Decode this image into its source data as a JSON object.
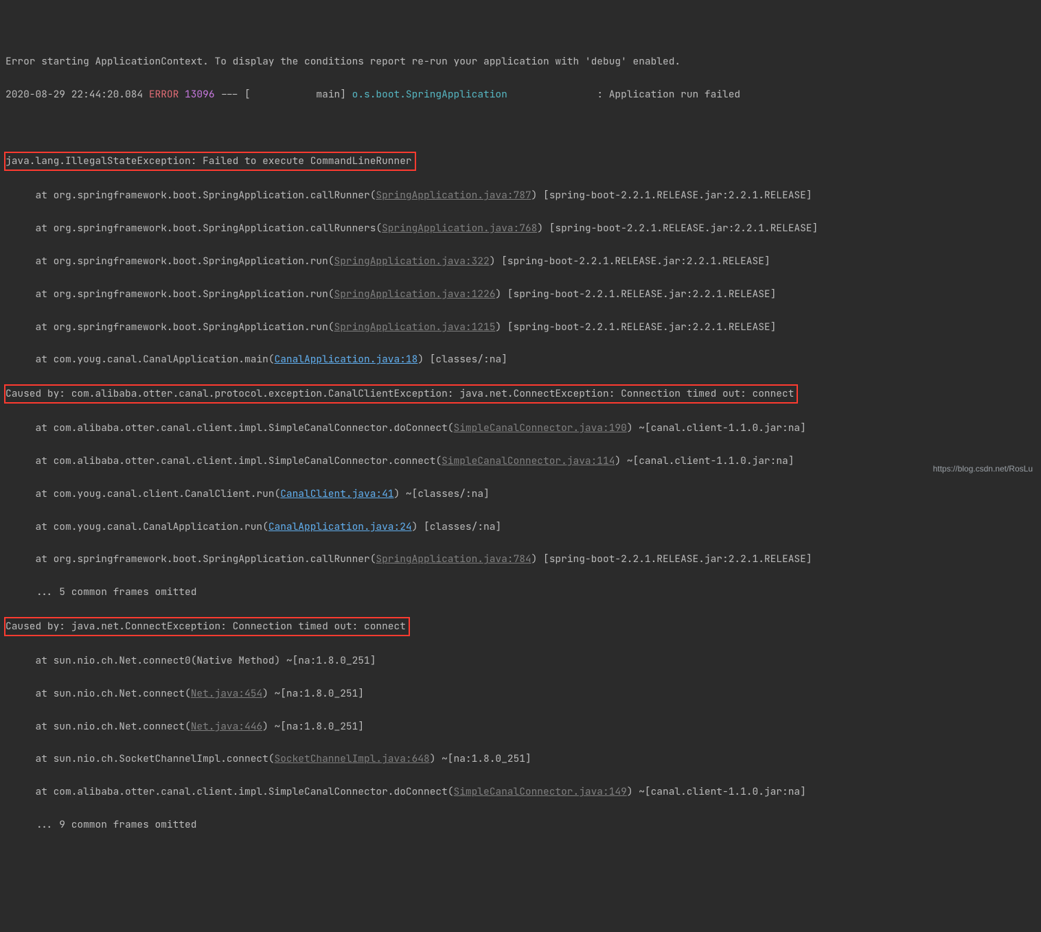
{
  "header": {
    "line1": "Error starting ApplicationContext. To display the conditions report re-run your application with 'debug' enabled.",
    "ts": "2020-08-29 22:44:20.084",
    "level": "ERROR",
    "pid": "13096",
    "dash": " --- [           main] ",
    "logger": "o.s.boot.SpringApplication",
    "pad": "               ",
    "msg": ": Application run failed"
  },
  "blank": " ",
  "ex1": {
    "title": "java.lang.IllegalStateException: Failed to execute CommandLineRunner",
    "f1a": "     at org.springframework.boot.SpringApplication.callRunner(",
    "f1l": "SpringApplication.java:787",
    "f1b": ") [spring-boot-2.2.1.RELEASE.jar:2.2.1.RELEASE]",
    "f2a": "     at org.springframework.boot.SpringApplication.callRunners(",
    "f2l": "SpringApplication.java:768",
    "f2b": ") [spring-boot-2.2.1.RELEASE.jar:2.2.1.RELEASE]",
    "f3a": "     at org.springframework.boot.SpringApplication.run(",
    "f3l": "SpringApplication.java:322",
    "f3b": ") [spring-boot-2.2.1.RELEASE.jar:2.2.1.RELEASE]",
    "f4a": "     at org.springframework.boot.SpringApplication.run(",
    "f4l": "SpringApplication.java:1226",
    "f4b": ") [spring-boot-2.2.1.RELEASE.jar:2.2.1.RELEASE]",
    "f5a": "     at org.springframework.boot.SpringApplication.run(",
    "f5l": "SpringApplication.java:1215",
    "f5b": ") [spring-boot-2.2.1.RELEASE.jar:2.2.1.RELEASE]",
    "f6a": "     at com.youg.canal.CanalApplication.main(",
    "f6l": "CanalApplication.java:18",
    "f6b": ") [classes/:na]"
  },
  "ex2": {
    "title": "Caused by: com.alibaba.otter.canal.protocol.exception.CanalClientException: java.net.ConnectException: Connection timed out: connect",
    "f1a": "     at com.alibaba.otter.canal.client.impl.SimpleCanalConnector.doConnect(",
    "f1l": "SimpleCanalConnector.java:190",
    "f1b": ") ~[canal.client-1.1.0.jar:na]",
    "f2a": "     at com.alibaba.otter.canal.client.impl.SimpleCanalConnector.connect(",
    "f2l": "SimpleCanalConnector.java:114",
    "f2b": ") ~[canal.client-1.1.0.jar:na]",
    "f3a": "     at com.youg.canal.client.CanalClient.run(",
    "f3l": "CanalClient.java:41",
    "f3b": ") ~[classes/:na]",
    "f4a": "     at com.youg.canal.CanalApplication.run(",
    "f4l": "CanalApplication.java:24",
    "f4b": ") [classes/:na]",
    "f5a": "     at org.springframework.boot.SpringApplication.callRunner(",
    "f5l": "SpringApplication.java:784",
    "f5b": ") [spring-boot-2.2.1.RELEASE.jar:2.2.1.RELEASE]",
    "om1": "     ... 5 common frames omitted"
  },
  "ex3": {
    "title": "Caused by: java.net.ConnectException: Connection timed out: connect",
    "f1": "     at sun.nio.ch.Net.connect0(Native Method) ~[na:1.8.0_251]",
    "f2a": "     at sun.nio.ch.Net.connect(",
    "f2l": "Net.java:454",
    "f2b": ") ~[na:1.8.0_251]",
    "f3a": "     at sun.nio.ch.Net.connect(",
    "f3l": "Net.java:446",
    "f3b": ") ~[na:1.8.0_251]",
    "f4a": "     at sun.nio.ch.SocketChannelImpl.connect(",
    "f4l": "SocketChannelImpl.java:648",
    "f4b": ") ~[na:1.8.0_251]",
    "f5a": "     at com.alibaba.otter.canal.client.impl.SimpleCanalConnector.doConnect(",
    "f5l": "SimpleCanalConnector.java:149",
    "f5b": ") ~[canal.client-1.1.0.jar:na]",
    "om2": "     ... 9 common frames omitted"
  },
  "watermark": "https://blog.csdn.net/RosLu"
}
